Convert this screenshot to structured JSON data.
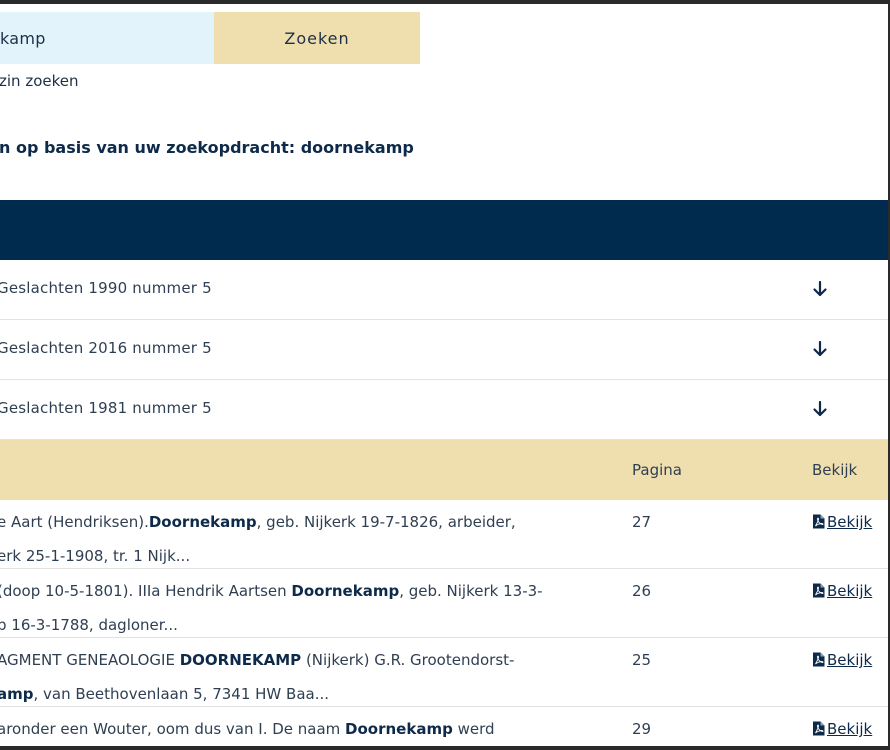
{
  "search": {
    "value": "kamp",
    "button_label": "Zoeken",
    "phrase_option": "zin zoeken"
  },
  "results_heading": "n op basis van uw zoekopdracht: doornekamp",
  "accordion": [
    {
      "title": "Geslachten 1990 nummer 5",
      "icon": "arrow-down-icon"
    },
    {
      "title": "Geslachten 2016 nummer 5",
      "icon": "arrow-down-icon"
    },
    {
      "title": "Geslachten 1981 nummer 5",
      "icon": "arrow-down-icon"
    }
  ],
  "results_table": {
    "headers": {
      "pagina": "Pagina",
      "bekijk": "Bekijk"
    },
    "rows": [
      {
        "line1": [
          {
            "t": "e Aart (Hendriksen)."
          },
          {
            "t": "Doornekamp",
            "b": true
          },
          {
            "t": ", geb. Nijkerk 19-7-1826, arbeider,"
          }
        ],
        "line2": [
          {
            "t": "erk 25-1-1908, tr. 1 Nijk..."
          }
        ],
        "page": "27",
        "view_label": "Bekijk"
      },
      {
        "line1": [
          {
            "t": "(doop 10-5-1801). IIIa Hendrik Aartsen "
          },
          {
            "t": "Doornekamp",
            "b": true
          },
          {
            "t": ", geb. Nijkerk 13-3-"
          }
        ],
        "line2": [
          {
            "t": "p 16-3-1788, dagloner..."
          }
        ],
        "page": "26",
        "view_label": "Bekijk"
      },
      {
        "line1": [
          {
            "t": "AGMENT GENEAOLOGIE "
          },
          {
            "t": "DOORNEKAMP",
            "b": true
          },
          {
            "t": " (Nijkerk) G.R. Grootendorst-"
          }
        ],
        "line2": [
          {
            "t": "amp",
            "b": true
          },
          {
            "t": ", van Beethovenlaan 5, 7341 HW Baa..."
          }
        ],
        "page": "25",
        "view_label": "Bekijk"
      },
      {
        "line1": [
          {
            "t": "aronder een Wouter, oom dus van I. De naam "
          },
          {
            "t": "Doornekamp",
            "b": true
          },
          {
            "t": " werd"
          }
        ],
        "line2": [],
        "page": "29",
        "view_label": "Bekijk"
      }
    ]
  },
  "colors": {
    "navy": "#012a4f",
    "sand": "#efdfaf",
    "light_blue": "#e3f3fb",
    "text": "#2f3f52"
  }
}
